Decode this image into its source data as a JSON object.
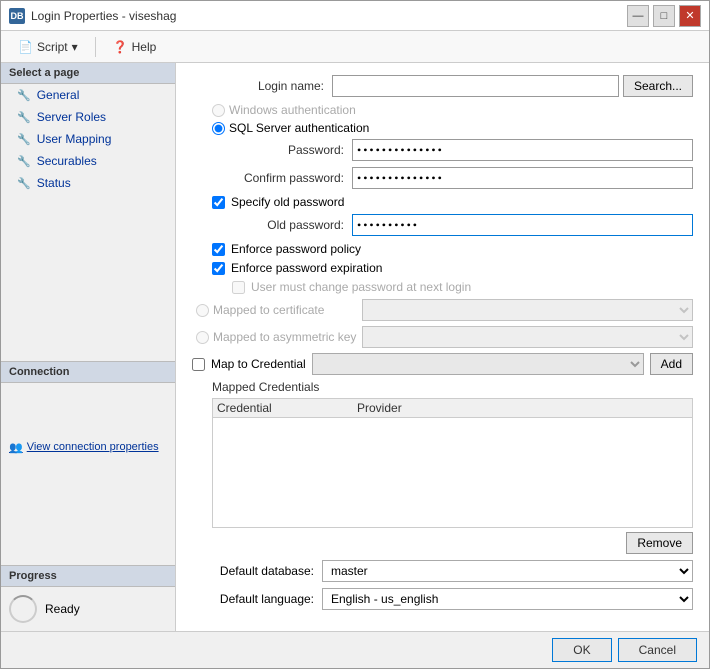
{
  "window": {
    "title": "Login Properties - viseshag",
    "icon": "DB"
  },
  "toolbar": {
    "script_label": "Script",
    "help_label": "Help"
  },
  "sidebar": {
    "select_page_label": "Select a page",
    "items": [
      {
        "id": "general",
        "label": "General"
      },
      {
        "id": "server-roles",
        "label": "Server Roles"
      },
      {
        "id": "user-mapping",
        "label": "User Mapping"
      },
      {
        "id": "securables",
        "label": "Securables"
      },
      {
        "id": "status",
        "label": "Status"
      }
    ],
    "connection_label": "Connection",
    "view_connection_label": "View connection properties",
    "progress_label": "Progress",
    "ready_label": "Ready"
  },
  "form": {
    "login_name_label": "Login name:",
    "login_name_value": "",
    "search_btn": "Search...",
    "windows_auth_label": "Windows authentication",
    "sql_auth_label": "SQL Server authentication",
    "password_label": "Password:",
    "password_value": "••••••••••••••",
    "confirm_password_label": "Confirm password:",
    "confirm_password_value": "••••••••••••••",
    "specify_old_password_label": "Specify old password",
    "old_password_label": "Old password:",
    "old_password_value": "••••••••••",
    "enforce_policy_label": "Enforce password policy",
    "enforce_expiration_label": "Enforce password expiration",
    "must_change_label": "User must change password at next login",
    "mapped_to_cert_label": "Mapped to certificate",
    "mapped_to_key_label": "Mapped to asymmetric key",
    "map_to_credential_label": "Map to Credential",
    "add_btn": "Add",
    "mapped_credentials_label": "Mapped Credentials",
    "credential_col": "Credential",
    "provider_col": "Provider",
    "remove_btn": "Remove",
    "default_database_label": "Default database:",
    "default_database_value": "master",
    "default_language_label": "Default language:",
    "default_language_value": "English - us_english"
  },
  "footer": {
    "ok_label": "OK",
    "cancel_label": "Cancel"
  },
  "icons": {
    "script": "📄",
    "help": "❓",
    "gear": "⚙",
    "wrench": "🔧",
    "connection": "🔗",
    "minimize": "—",
    "maximize": "□",
    "close": "✕"
  }
}
